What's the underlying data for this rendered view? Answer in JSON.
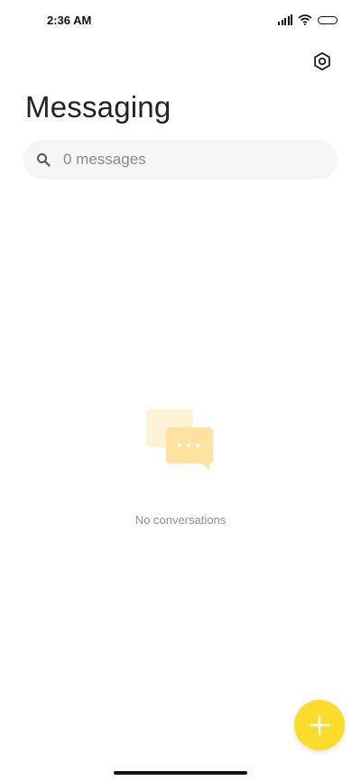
{
  "status_bar": {
    "time": "2:36 AM"
  },
  "header": {
    "title": "Messaging"
  },
  "search": {
    "placeholder": "0 messages"
  },
  "empty_state": {
    "text": "No conversations"
  },
  "icons": {
    "settings": "gear-icon",
    "search": "search-icon",
    "empty": "chat-bubbles-icon",
    "fab": "plus-icon"
  },
  "colors": {
    "accent": "#fbdc2b",
    "illustration_light": "#fdf0c8",
    "illustration_dark": "#fde4a6"
  }
}
